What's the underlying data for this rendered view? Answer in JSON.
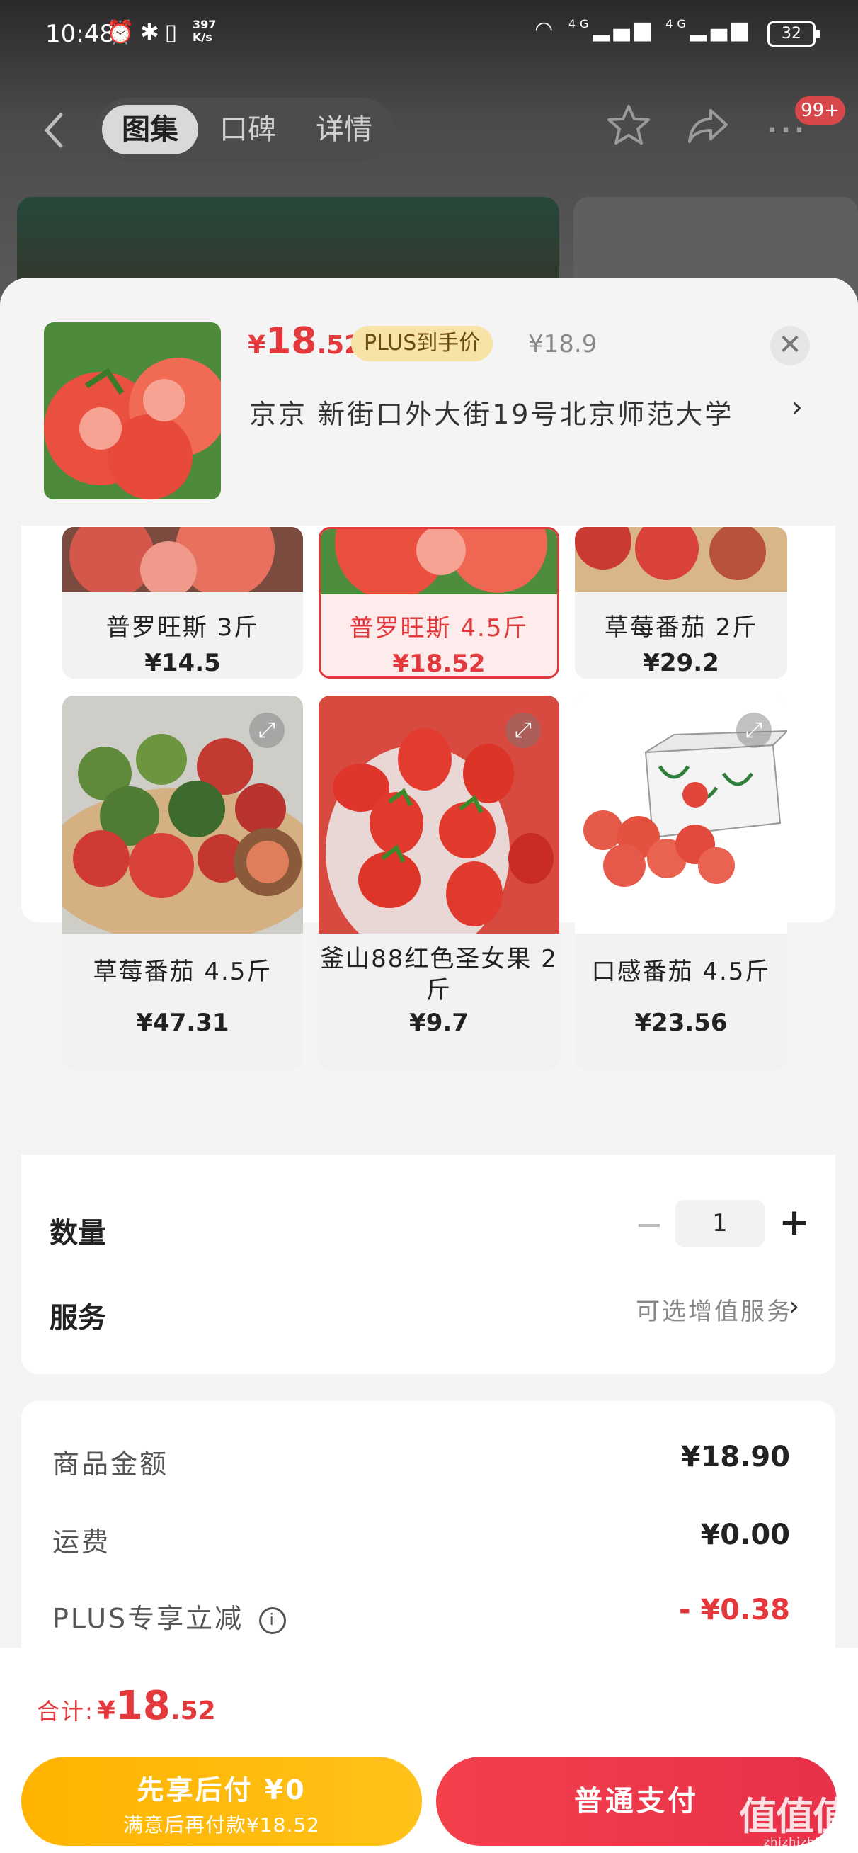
{
  "status_bar": {
    "time": "10:48",
    "net_speed": "397\nK/s",
    "battery": "32",
    "signal_1": "4G",
    "signal_2": "4G"
  },
  "nav": {
    "tabs": [
      {
        "label": "图集"
      },
      {
        "label": "口碑"
      },
      {
        "label": "详情"
      }
    ],
    "cart_badge": "99+"
  },
  "product": {
    "price_symbol": "¥",
    "price_int": "18",
    "price_dec": ".52",
    "plus_tag": "PLUS到手价",
    "original_price": "¥18.9",
    "address": "京京   新街口外大街19号北京师范大学"
  },
  "variants": [
    {
      "name": "普罗旺斯 3斤",
      "price": "¥14.5",
      "selected": false
    },
    {
      "name": "普罗旺斯 4.5斤",
      "price": "¥18.52",
      "selected": true
    },
    {
      "name": "草莓番茄 2斤",
      "price": "¥29.2",
      "selected": false
    },
    {
      "name": "草莓番茄 4.5斤",
      "price": "¥47.31",
      "selected": false
    },
    {
      "name": "釜山88红色圣女果 2斤",
      "price": "¥9.7",
      "selected": false
    },
    {
      "name": "口感番茄 4.5斤",
      "price": "¥23.56",
      "selected": false
    }
  ],
  "quantity": {
    "label": "数量",
    "value": "1"
  },
  "service": {
    "label": "服务",
    "hint": "可选增值服务"
  },
  "summary": {
    "rows": [
      {
        "label": "商品金额",
        "value": "¥18.90"
      },
      {
        "label": "运费",
        "value": "¥0.00"
      },
      {
        "label": "PLUS专享立减",
        "value": "- ¥0.38"
      }
    ]
  },
  "footer": {
    "total_label": "合计:",
    "total_symbol": "¥",
    "total_int": "18",
    "total_dec": ".52",
    "pay_later_title": "先享后付 ¥0",
    "pay_later_sub": "满意后再付款¥18.52",
    "pay_now": "普通支付"
  },
  "watermark": {
    "main": "值值值",
    "sub": "zhizhizhi.com"
  },
  "colors": {
    "accent": "#e4393c",
    "plus_gold": "#f7e3a6",
    "pay_later": "#ffb300"
  }
}
